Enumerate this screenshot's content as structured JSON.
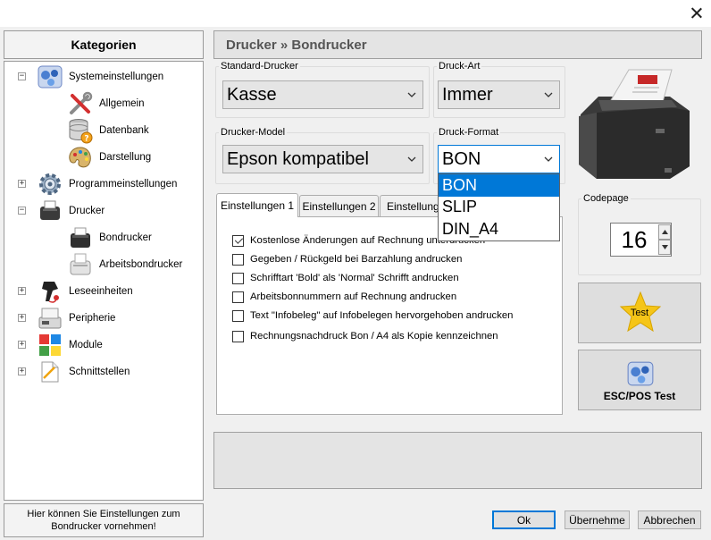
{
  "categories_header": "Kategorien",
  "tree": [
    {
      "label": "Systemeinstellungen",
      "icon": "system-settings-icon",
      "expander": "−"
    },
    {
      "label": "Allgemein",
      "icon": "tools-icon"
    },
    {
      "label": "Datenbank",
      "icon": "database-icon"
    },
    {
      "label": "Darstellung",
      "icon": "palette-icon"
    },
    {
      "label": "Programmeinstellungen",
      "icon": "gear-icon",
      "expander": "+"
    },
    {
      "label": "Drucker",
      "icon": "printer-icon",
      "expander": "−"
    },
    {
      "label": "Bondrucker",
      "icon": "receipt-printer-icon"
    },
    {
      "label": "Arbeitsbondrucker",
      "icon": "work-printer-icon"
    },
    {
      "label": "Leseeinheiten",
      "icon": "scanner-icon",
      "expander": "+"
    },
    {
      "label": "Peripherie",
      "icon": "peripheral-icon",
      "expander": "+"
    },
    {
      "label": "Module",
      "icon": "modules-icon",
      "expander": "+"
    },
    {
      "label": "Schnittstellen",
      "icon": "interfaces-icon",
      "expander": "+"
    }
  ],
  "hint_text": "Hier können Sie Einstellungen zum Bondrucker vornehmen!",
  "page_title": "Drucker » Bondrucker",
  "standard_printer": {
    "legend": "Standard-Drucker",
    "value": "Kasse"
  },
  "print_type": {
    "legend": "Druck-Art",
    "value": "Immer"
  },
  "printer_model": {
    "legend": "Drucker-Model",
    "value": "Epson kompatibel"
  },
  "print_format": {
    "legend": "Druck-Format",
    "value": "BON",
    "options": [
      "BON",
      "SLIP",
      "DIN_A4"
    ],
    "selected_option": "BON"
  },
  "tabs": [
    "Einstellungen 1",
    "Einstellungen 2",
    "Einstellungen"
  ],
  "checkboxes": [
    {
      "label": "Kostenlose Änderungen auf Rechnung unterdrucken",
      "checked": true
    },
    {
      "label": "Gegeben / Rückgeld bei Barzahlung  andrucken",
      "checked": false
    },
    {
      "label": "Schrifftart 'Bold' als 'Normal' Schrifft andrucken",
      "checked": false
    },
    {
      "label": "Arbeitsbonnummern auf Rechnung andrucken",
      "checked": false
    },
    {
      "label": "Text \"Infobeleg\" auf Infobelegen hervorgehoben andrucken",
      "checked": false
    },
    {
      "label": "Rechnungsnachdruck Bon / A4 als Kopie kennzeichnen",
      "checked": false
    }
  ],
  "codepage": {
    "legend": "Codepage",
    "value": "16"
  },
  "test_button": "Test",
  "escpos_button": "ESC/POS Test",
  "ok_button": "Ok",
  "apply_button": "Übernehme",
  "cancel_button": "Abbrechen",
  "colors": {
    "accent": "#0078d7",
    "dialog_bg": "#f0f0f0",
    "star": "#f5c518"
  }
}
